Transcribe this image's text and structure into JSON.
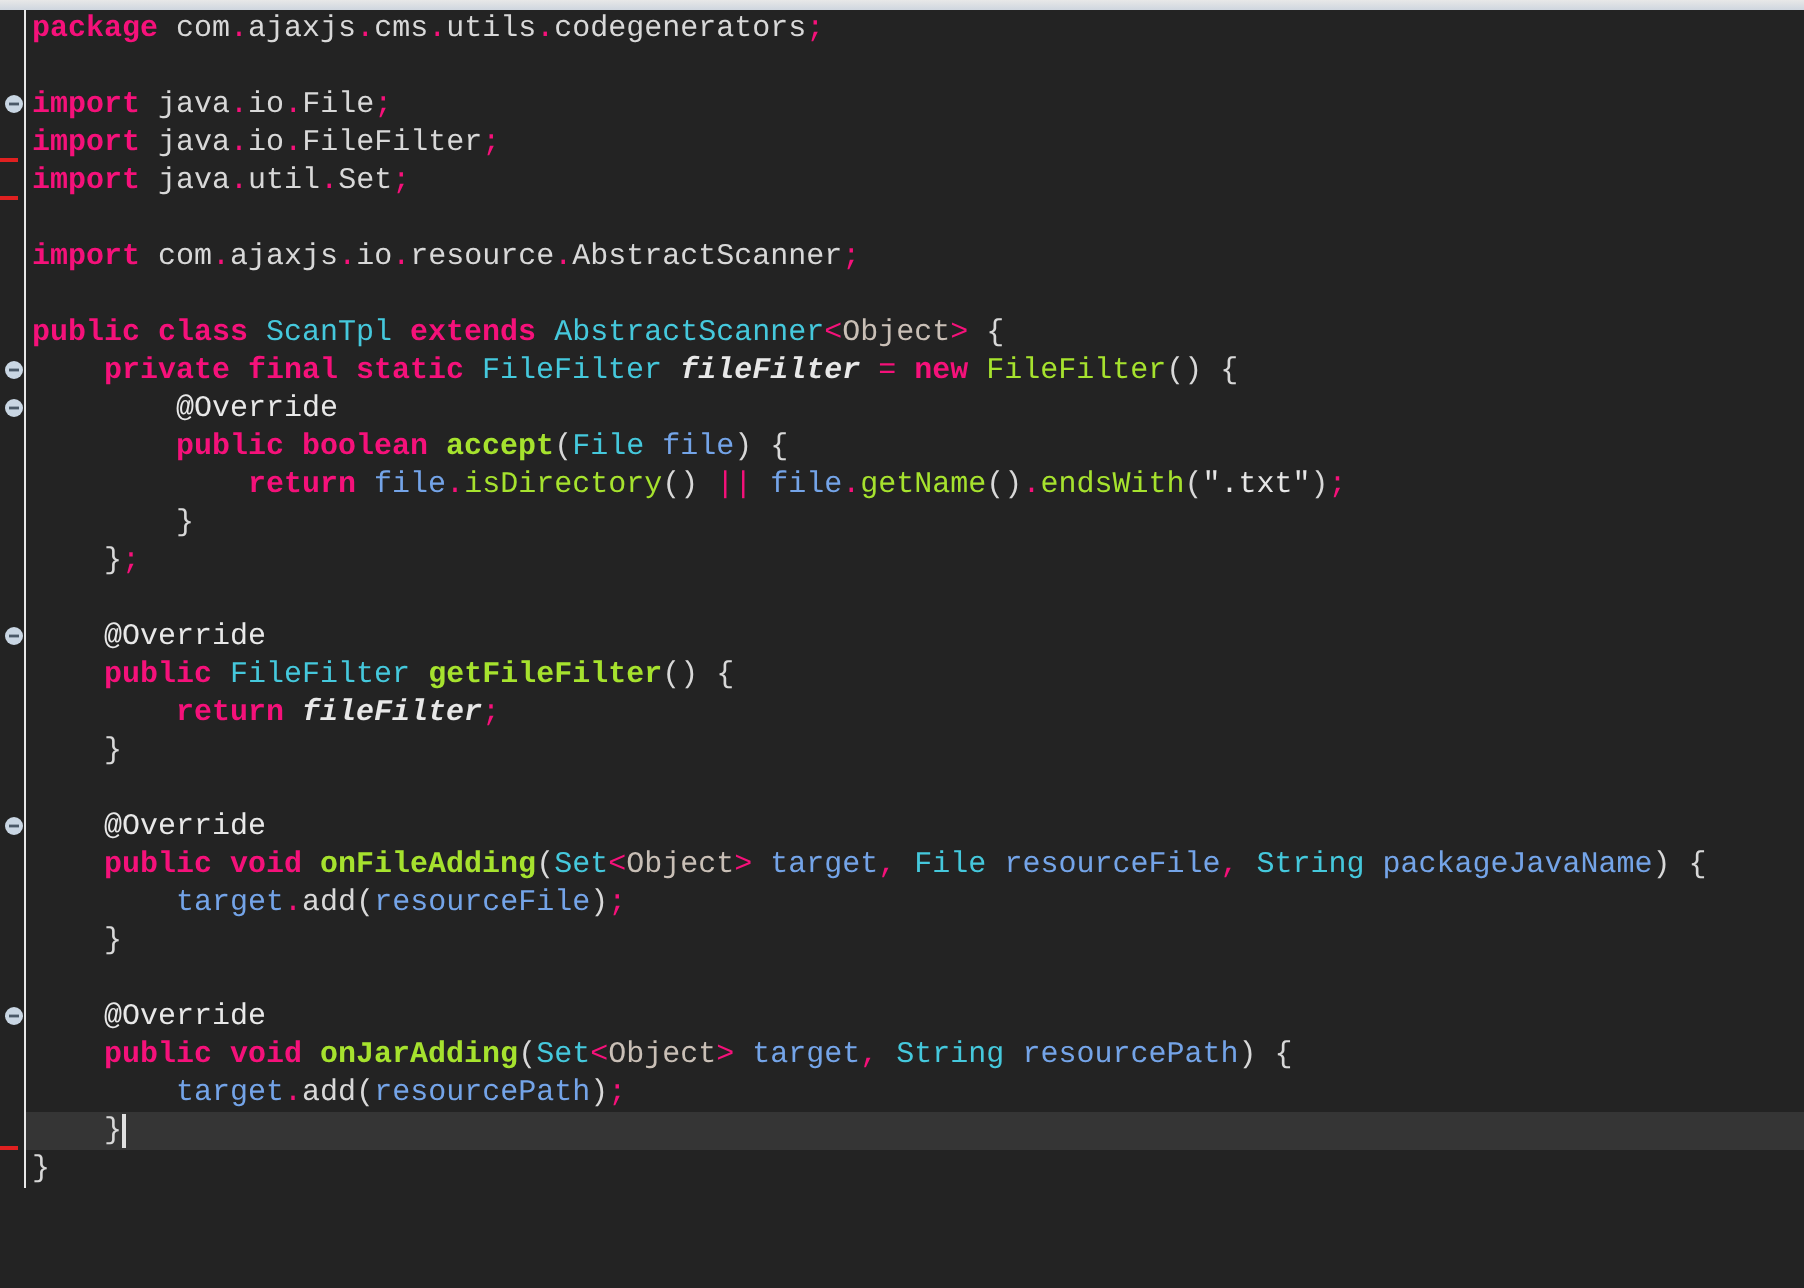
{
  "editor": {
    "lines": [
      {
        "fold": false,
        "marked": false,
        "current": false,
        "tokens": [
          {
            "text": "package ",
            "kind": "kw"
          },
          {
            "text": "com",
            "kind": "plain"
          },
          {
            "text": ".",
            "kind": "punct"
          },
          {
            "text": "ajaxjs",
            "kind": "plain"
          },
          {
            "text": ".",
            "kind": "punct"
          },
          {
            "text": "cms",
            "kind": "plain"
          },
          {
            "text": ".",
            "kind": "punct"
          },
          {
            "text": "utils",
            "kind": "plain"
          },
          {
            "text": ".",
            "kind": "punct"
          },
          {
            "text": "codegenerators",
            "kind": "plain"
          },
          {
            "text": ";",
            "kind": "punct"
          }
        ]
      },
      {
        "fold": false,
        "marked": false,
        "current": false
      },
      {
        "fold": true,
        "marked": false,
        "current": false,
        "tokens": [
          {
            "text": "import ",
            "kind": "kw"
          },
          {
            "text": "java",
            "kind": "plain"
          },
          {
            "text": ".",
            "kind": "punct"
          },
          {
            "text": "io",
            "kind": "plain"
          },
          {
            "text": ".",
            "kind": "punct"
          },
          {
            "text": "File",
            "kind": "plain"
          },
          {
            "text": ";",
            "kind": "punct"
          }
        ]
      },
      {
        "fold": false,
        "marked": true,
        "current": false,
        "tokens": [
          {
            "text": "import ",
            "kind": "kw"
          },
          {
            "text": "java",
            "kind": "plain"
          },
          {
            "text": ".",
            "kind": "punct"
          },
          {
            "text": "io",
            "kind": "plain"
          },
          {
            "text": ".",
            "kind": "punct"
          },
          {
            "text": "FileFilter",
            "kind": "plain"
          },
          {
            "text": ";",
            "kind": "punct"
          }
        ]
      },
      {
        "fold": false,
        "marked": true,
        "current": false,
        "tokens": [
          {
            "text": "import ",
            "kind": "kw"
          },
          {
            "text": "java",
            "kind": "plain"
          },
          {
            "text": ".",
            "kind": "punct"
          },
          {
            "text": "util",
            "kind": "plain"
          },
          {
            "text": ".",
            "kind": "punct"
          },
          {
            "text": "Set",
            "kind": "plain"
          },
          {
            "text": ";",
            "kind": "punct"
          }
        ]
      },
      {
        "fold": false,
        "marked": false,
        "current": false
      },
      {
        "fold": false,
        "marked": false,
        "current": false,
        "tokens": [
          {
            "text": "import ",
            "kind": "kw"
          },
          {
            "text": "com",
            "kind": "plain"
          },
          {
            "text": ".",
            "kind": "punct"
          },
          {
            "text": "ajaxjs",
            "kind": "plain"
          },
          {
            "text": ".",
            "kind": "punct"
          },
          {
            "text": "io",
            "kind": "plain"
          },
          {
            "text": ".",
            "kind": "punct"
          },
          {
            "text": "resource",
            "kind": "plain"
          },
          {
            "text": ".",
            "kind": "punct"
          },
          {
            "text": "AbstractScanner",
            "kind": "plain"
          },
          {
            "text": ";",
            "kind": "punct"
          }
        ]
      },
      {
        "fold": false,
        "marked": false,
        "current": false
      },
      {
        "fold": false,
        "marked": false,
        "current": false,
        "tokens": [
          {
            "text": "public class ",
            "kind": "kw"
          },
          {
            "text": "ScanTpl ",
            "kind": "type"
          },
          {
            "text": "extends ",
            "kind": "kw"
          },
          {
            "text": "AbstractScanner",
            "kind": "type"
          },
          {
            "text": "<",
            "kind": "punct"
          },
          {
            "text": "Object",
            "kind": "generic"
          },
          {
            "text": ">",
            "kind": "punct"
          },
          {
            "text": " {",
            "kind": "plain"
          }
        ]
      },
      {
        "fold": true,
        "marked": false,
        "current": false,
        "tokens": [
          {
            "text": "    private final static ",
            "kind": "kw"
          },
          {
            "text": "FileFilter ",
            "kind": "type"
          },
          {
            "text": "fileFilter ",
            "kind": "field"
          },
          {
            "text": "=",
            "kind": "punct"
          },
          {
            "text": " new ",
            "kind": "kw"
          },
          {
            "text": "FileFilter",
            "kind": "call"
          },
          {
            "text": "() {",
            "kind": "plain"
          }
        ]
      },
      {
        "fold": true,
        "marked": false,
        "current": false,
        "tokens": [
          {
            "text": "        @Override",
            "kind": "annot"
          }
        ]
      },
      {
        "fold": false,
        "marked": false,
        "current": false,
        "tokens": [
          {
            "text": "        public boolean ",
            "kind": "kw"
          },
          {
            "text": "accept",
            "kind": "method"
          },
          {
            "text": "(",
            "kind": "plain"
          },
          {
            "text": "File ",
            "kind": "type"
          },
          {
            "text": "file",
            "kind": "var"
          },
          {
            "text": ") {",
            "kind": "plain"
          }
        ]
      },
      {
        "fold": false,
        "marked": false,
        "current": false,
        "tokens": [
          {
            "text": "            return ",
            "kind": "kw"
          },
          {
            "text": "file",
            "kind": "var"
          },
          {
            "text": ".",
            "kind": "punct"
          },
          {
            "text": "isDirectory",
            "kind": "call"
          },
          {
            "text": "() ",
            "kind": "plain"
          },
          {
            "text": "|| ",
            "kind": "punct"
          },
          {
            "text": "file",
            "kind": "var"
          },
          {
            "text": ".",
            "kind": "punct"
          },
          {
            "text": "getName",
            "kind": "call"
          },
          {
            "text": "()",
            "kind": "plain"
          },
          {
            "text": ".",
            "kind": "punct"
          },
          {
            "text": "endsWith",
            "kind": "call"
          },
          {
            "text": "(",
            "kind": "plain"
          },
          {
            "text": "\".txt\"",
            "kind": "str"
          },
          {
            "text": ")",
            "kind": "plain"
          },
          {
            "text": ";",
            "kind": "punct"
          }
        ]
      },
      {
        "fold": false,
        "marked": false,
        "current": false,
        "tokens": [
          {
            "text": "        }",
            "kind": "plain"
          }
        ]
      },
      {
        "fold": false,
        "marked": false,
        "current": false,
        "tokens": [
          {
            "text": "    }",
            "kind": "plain"
          },
          {
            "text": ";",
            "kind": "punct"
          }
        ]
      },
      {
        "fold": false,
        "marked": false,
        "current": false
      },
      {
        "fold": true,
        "marked": false,
        "current": false,
        "tokens": [
          {
            "text": "    @Override",
            "kind": "annot"
          }
        ]
      },
      {
        "fold": false,
        "marked": false,
        "current": false,
        "tokens": [
          {
            "text": "    public ",
            "kind": "kw"
          },
          {
            "text": "FileFilter ",
            "kind": "type"
          },
          {
            "text": "getFileFilter",
            "kind": "method"
          },
          {
            "text": "() {",
            "kind": "plain"
          }
        ]
      },
      {
        "fold": false,
        "marked": false,
        "current": false,
        "tokens": [
          {
            "text": "        return ",
            "kind": "kw"
          },
          {
            "text": "fileFilter",
            "kind": "field"
          },
          {
            "text": ";",
            "kind": "punct"
          }
        ]
      },
      {
        "fold": false,
        "marked": false,
        "current": false,
        "tokens": [
          {
            "text": "    }",
            "kind": "plain"
          }
        ]
      },
      {
        "fold": false,
        "marked": false,
        "current": false
      },
      {
        "fold": true,
        "marked": false,
        "current": false,
        "tokens": [
          {
            "text": "    @Override",
            "kind": "annot"
          }
        ]
      },
      {
        "fold": false,
        "marked": false,
        "current": false,
        "tokens": [
          {
            "text": "    public void ",
            "kind": "kw"
          },
          {
            "text": "onFileAdding",
            "kind": "method"
          },
          {
            "text": "(",
            "kind": "plain"
          },
          {
            "text": "Set",
            "kind": "type"
          },
          {
            "text": "<",
            "kind": "punct"
          },
          {
            "text": "Object",
            "kind": "generic"
          },
          {
            "text": "> ",
            "kind": "punct"
          },
          {
            "text": "target",
            "kind": "var"
          },
          {
            "text": ", ",
            "kind": "punct"
          },
          {
            "text": "File ",
            "kind": "type"
          },
          {
            "text": "resourceFile",
            "kind": "var"
          },
          {
            "text": ", ",
            "kind": "punct"
          },
          {
            "text": "String ",
            "kind": "type"
          },
          {
            "text": "packageJavaName",
            "kind": "var"
          },
          {
            "text": ") {",
            "kind": "plain"
          }
        ]
      },
      {
        "fold": false,
        "marked": false,
        "current": false,
        "tokens": [
          {
            "text": "        target",
            "kind": "var"
          },
          {
            "text": ".",
            "kind": "punct"
          },
          {
            "text": "add(",
            "kind": "plain"
          },
          {
            "text": "resourceFile",
            "kind": "var"
          },
          {
            "text": ")",
            "kind": "plain"
          },
          {
            "text": ";",
            "kind": "punct"
          }
        ]
      },
      {
        "fold": false,
        "marked": false,
        "current": false,
        "tokens": [
          {
            "text": "    }",
            "kind": "plain"
          }
        ]
      },
      {
        "fold": false,
        "marked": false,
        "current": false
      },
      {
        "fold": true,
        "marked": false,
        "current": false,
        "tokens": [
          {
            "text": "    @Override",
            "kind": "annot"
          }
        ]
      },
      {
        "fold": false,
        "marked": false,
        "current": false,
        "tokens": [
          {
            "text": "    public void ",
            "kind": "kw"
          },
          {
            "text": "onJarAdding",
            "kind": "method"
          },
          {
            "text": "(",
            "kind": "plain"
          },
          {
            "text": "Set",
            "kind": "type"
          },
          {
            "text": "<",
            "kind": "punct"
          },
          {
            "text": "Object",
            "kind": "generic"
          },
          {
            "text": "> ",
            "kind": "punct"
          },
          {
            "text": "target",
            "kind": "var"
          },
          {
            "text": ", ",
            "kind": "punct"
          },
          {
            "text": "String ",
            "kind": "type"
          },
          {
            "text": "resourcePath",
            "kind": "var"
          },
          {
            "text": ") {",
            "kind": "plain"
          }
        ]
      },
      {
        "fold": false,
        "marked": false,
        "current": false,
        "tokens": [
          {
            "text": "        target",
            "kind": "var"
          },
          {
            "text": ".",
            "kind": "punct"
          },
          {
            "text": "add(",
            "kind": "plain"
          },
          {
            "text": "resourcePath",
            "kind": "var"
          },
          {
            "text": ")",
            "kind": "plain"
          },
          {
            "text": ";",
            "kind": "punct"
          }
        ]
      },
      {
        "fold": false,
        "marked": true,
        "current": true,
        "tokens": [
          {
            "text": "    }",
            "kind": "plain"
          }
        ]
      },
      {
        "fold": false,
        "marked": false,
        "current": false,
        "tokens": [
          {
            "text": "}",
            "kind": "plain"
          }
        ]
      }
    ]
  }
}
